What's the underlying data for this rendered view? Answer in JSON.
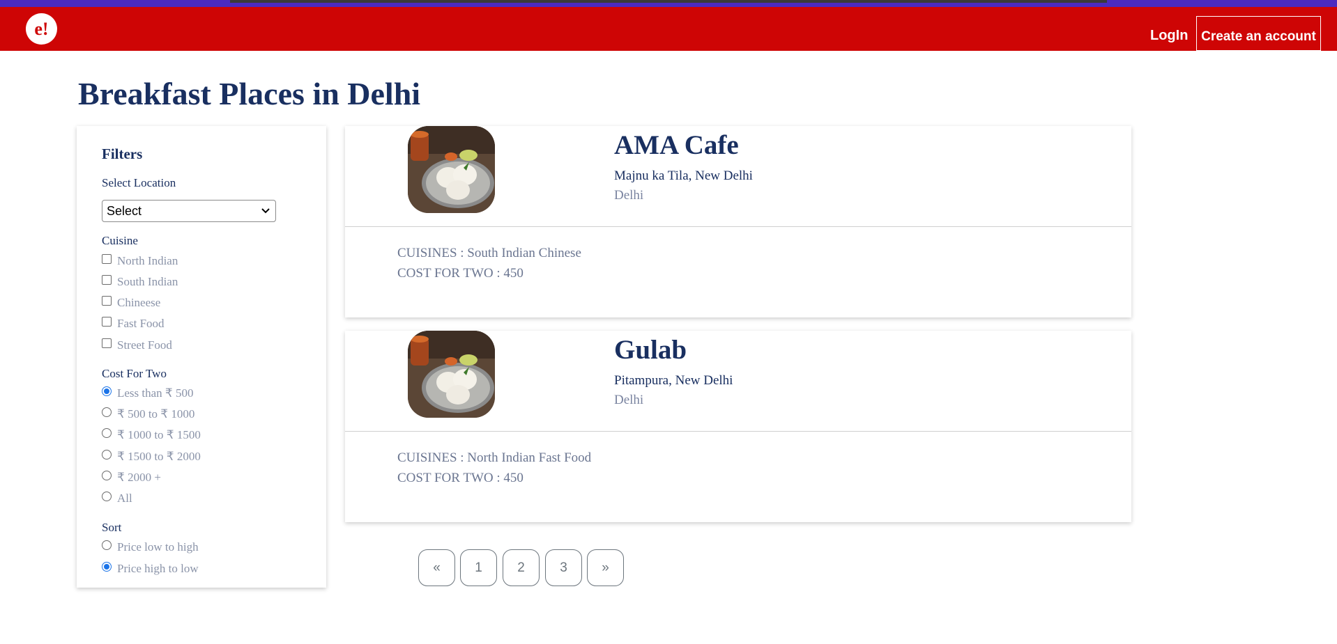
{
  "header": {
    "logo_text": "e!",
    "login_label": "LogIn",
    "create_account_label": "Create an account",
    "brand_color": "#ce0505"
  },
  "page_title": "Breakfast Places in Delhi",
  "filters": {
    "title": "Filters",
    "location_label": "Select Location",
    "location_selected": "Select",
    "cuisine_label": "Cuisine",
    "cuisines": [
      {
        "label": "North Indian",
        "checked": false
      },
      {
        "label": "South Indian",
        "checked": false
      },
      {
        "label": "Chineese",
        "checked": false
      },
      {
        "label": "Fast Food",
        "checked": false
      },
      {
        "label": "Street Food",
        "checked": false
      }
    ],
    "cost_label": "Cost For Two",
    "costs": [
      {
        "label": "Less than ₹ 500",
        "selected": true
      },
      {
        "label": "₹ 500 to ₹ 1000",
        "selected": false
      },
      {
        "label": "₹ 1000 to ₹ 1500",
        "selected": false
      },
      {
        "label": "₹ 1500 to ₹ 2000",
        "selected": false
      },
      {
        "label": "₹ 2000 +",
        "selected": false
      },
      {
        "label": "All",
        "selected": false
      }
    ],
    "sort_label": "Sort",
    "sorts": [
      {
        "label": "Price low to high",
        "selected": false
      },
      {
        "label": "Price high to low",
        "selected": true
      }
    ]
  },
  "results": [
    {
      "name": "AMA Cafe",
      "address": "Majnu ka Tila, New Delhi",
      "city": "Delhi",
      "cuisines": "CUISINES : South Indian Chinese",
      "cost": "COST FOR TWO : 450"
    },
    {
      "name": "Gulab",
      "address": "Pitampura, New Delhi",
      "city": "Delhi",
      "cuisines": "CUISINES : North Indian Fast Food",
      "cost": "COST FOR TWO : 450"
    }
  ],
  "pagination": {
    "prev": "«",
    "pages": [
      "1",
      "2",
      "3"
    ],
    "next": "»"
  }
}
